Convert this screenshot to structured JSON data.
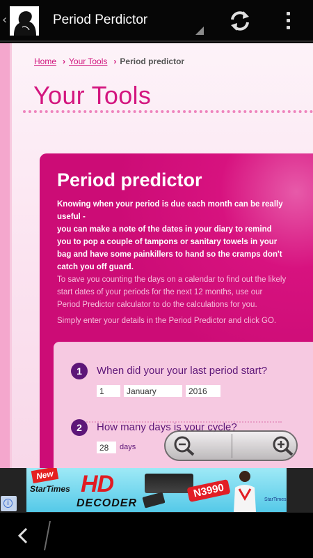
{
  "app": {
    "title": "Period Perdictor"
  },
  "breadcrumb": {
    "home": "Home",
    "tools": "Your Tools",
    "current": "Period predictor"
  },
  "page": {
    "heading": "Your Tools"
  },
  "panel": {
    "title": "Period predictor",
    "intro_line1": "Knowing when your period is due each month can be really useful -",
    "intro_line2": "you can make a note of the dates in your diary to remind you to pop a couple of tampons or sanitary towels in your bag and have some painkillers to hand so the cramps don't catch you off guard.",
    "para1": "To save you counting the days on a calendar to find out the likely start dates of your periods for the next 12 months, use our Period Predictor calculator to do the calculations for you.",
    "para2": "Simply enter your details in the Period Predictor and click GO."
  },
  "form": {
    "step1": {
      "number": "1",
      "label": "When did your your last period start?",
      "day": "1",
      "month": "January",
      "year": "2016"
    },
    "step2": {
      "number": "2",
      "label": "How many days is your cycle?",
      "days_value": "28",
      "days_unit": "days"
    }
  },
  "ad": {
    "new_badge": "New",
    "brand": "StarTimes",
    "headline": "HD",
    "product": "DECODER",
    "price": "N3990",
    "logo_text": "StarTimes",
    "info_icon": "i"
  },
  "colors": {
    "accent": "#d3167f",
    "panel": "#cc0c76",
    "step": "#5d1678",
    "form_bg": "#f6c9e1"
  }
}
